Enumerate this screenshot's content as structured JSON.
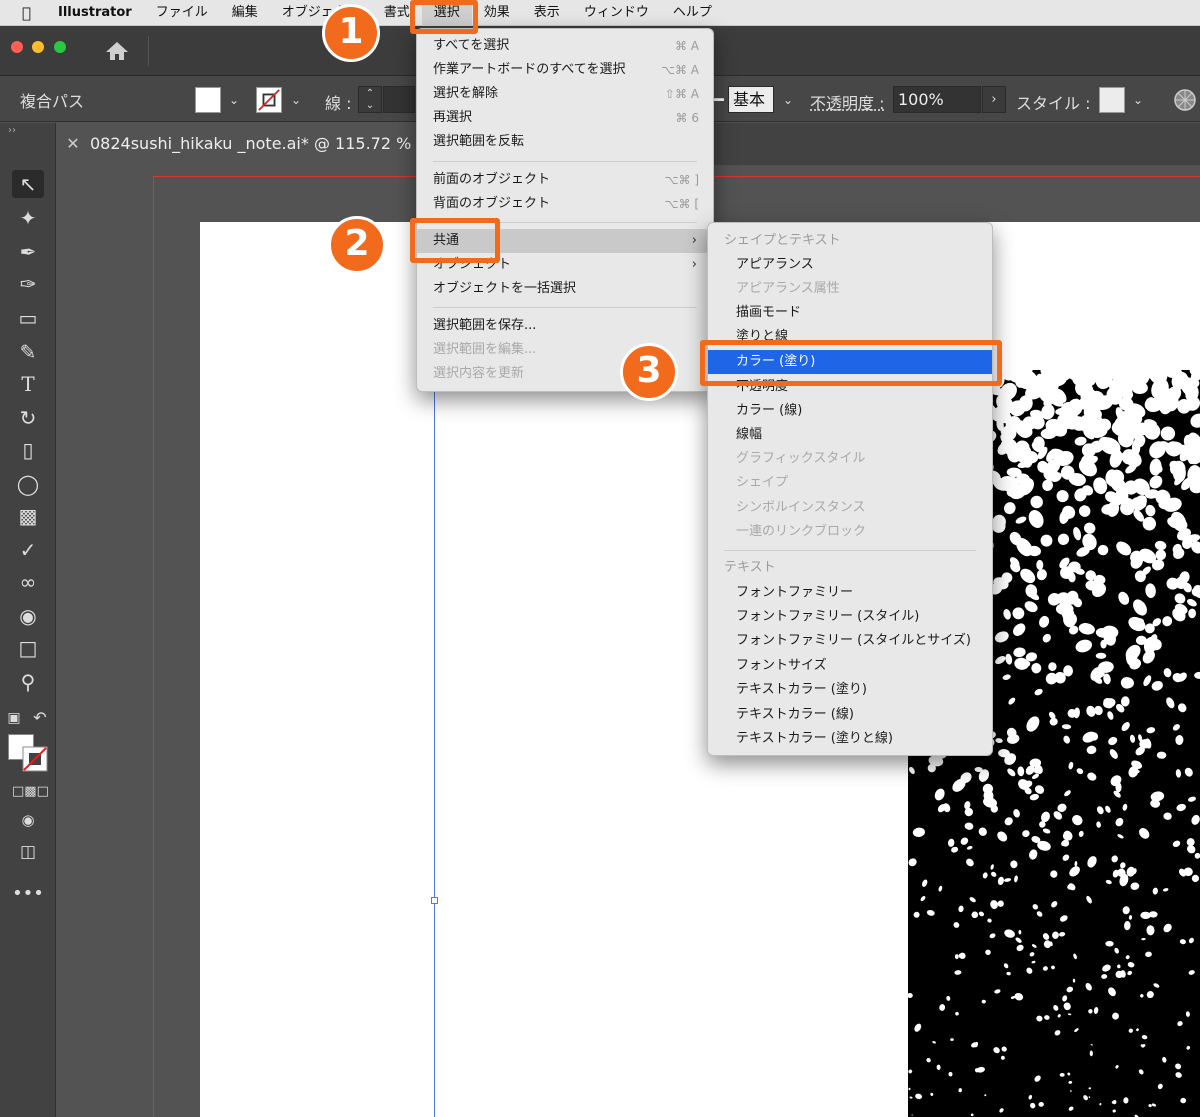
{
  "menubar": {
    "items": [
      "Illustrator",
      "ファイル",
      "編集",
      "オブジェクト",
      "書式",
      "選択",
      "効果",
      "表示",
      "ウィンドウ",
      "ヘルプ"
    ]
  },
  "controlbar": {
    "object_type": "複合パス",
    "stroke_label": "線 :",
    "profile": "基本",
    "opacity_label": "不透明度 :",
    "opacity_value": "100%",
    "style_label": "スタイル :"
  },
  "document_tab": {
    "title": "0824sushi_hikaku _note.ai* @ 115.72 % (RGB"
  },
  "select_menu": {
    "items": [
      {
        "label": "すべてを選択",
        "shortcut": "⌘ A"
      },
      {
        "label": "作業アートボードのすべてを選択",
        "shortcut": "⌥⌘ A"
      },
      {
        "label": "選択を解除",
        "shortcut": "⇧⌘ A"
      },
      {
        "label": "再選択",
        "shortcut": "⌘ 6"
      },
      {
        "label": "選択範囲を反転",
        "shortcut": ""
      },
      {
        "label": "前面のオブジェクト",
        "shortcut": "⌥⌘ ]"
      },
      {
        "label": "背面のオブジェクト",
        "shortcut": "⌥⌘ ["
      },
      {
        "label": "共通",
        "shortcut": ""
      },
      {
        "label": "オブジェクト",
        "shortcut": ""
      },
      {
        "label": "オブジェクトを一括選択",
        "shortcut": ""
      },
      {
        "label": "選択範囲を保存...",
        "shortcut": ""
      },
      {
        "label": "選択範囲を編集...",
        "shortcut": ""
      },
      {
        "label": "選択内容を更新",
        "shortcut": ""
      }
    ]
  },
  "same_submenu": {
    "header_shape": "シェイプとテキスト",
    "header_text": "テキスト",
    "items": [
      "アピアランス",
      "アピアランス属性",
      "描画モード",
      "塗りと線",
      "カラー (塗り)",
      "不透明度",
      "カラー (線)",
      "線幅",
      "グラフィックスタイル",
      "シェイプ",
      "シンボルインスタンス",
      "一連のリンクブロック",
      "フォントファミリー",
      "フォントファミリー (スタイル)",
      "フォントファミリー (スタイルとサイズ)",
      "フォントサイズ",
      "テキストカラー (塗り)",
      "テキストカラー (線)",
      "テキストカラー (塗りと線)"
    ]
  },
  "annotations": {
    "step1": "1",
    "step2": "2",
    "step3": "3",
    "color": "#f26a1b"
  }
}
